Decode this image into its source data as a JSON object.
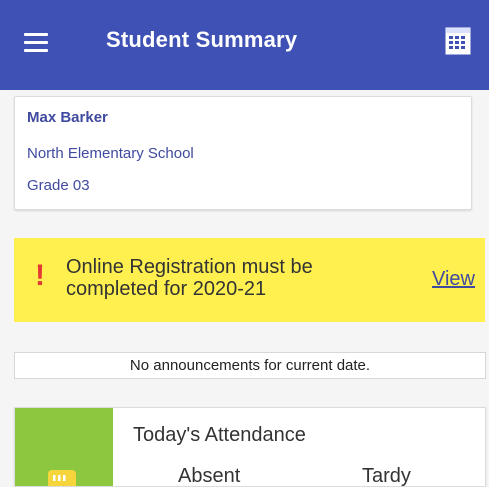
{
  "app": {
    "title": "Student Summary",
    "menu_icon": "menu-icon",
    "calendar_icon": "calendar-icon"
  },
  "student": {
    "name": "Max Barker",
    "school": "North Elementary School",
    "grade": "Grade 03"
  },
  "alert": {
    "icon": "exclamation-icon",
    "message": "Online Registration must be completed for 2020-21",
    "action_label": "View",
    "background_color": "#fff04f",
    "icon_color": "#e53935"
  },
  "announcements": {
    "message": "No announcements for current date."
  },
  "attendance": {
    "title": "Today's Attendance",
    "absent_label": "Absent",
    "tardy_label": "Tardy",
    "icon": "attendance-icon",
    "accent_color": "#8dc63f"
  },
  "colors": {
    "primary": "#3f51b5",
    "link": "#3f4aa0"
  }
}
